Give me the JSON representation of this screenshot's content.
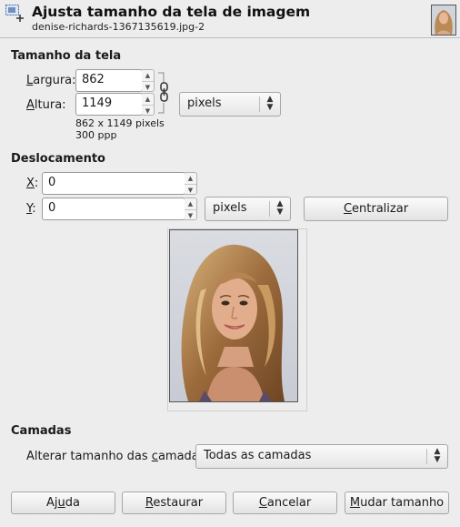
{
  "header": {
    "title": "Ajusta tamanho da tela de imagem",
    "subtitle": "denise-richards-1367135619.jpg-2",
    "icon": "canvas-size-icon",
    "thumbnail": "portrait-thumbnail"
  },
  "canvas_size": {
    "section_title": "Tamanho da tela",
    "width_label_prefix": "L",
    "width_label_rest": "argura:",
    "width_value": "862",
    "height_label_prefix": "A",
    "height_label_rest": "ltura:",
    "height_value": "1149",
    "unit": "pixels",
    "info_size": "862 x 1149 pixels",
    "info_resolution": "300 ppp",
    "chain_icon": "chain-link-icon"
  },
  "offset": {
    "section_title": "Deslocamento",
    "x_label_prefix": "X",
    "x_label_rest": ":",
    "x_value": "0",
    "y_label_prefix": "Y",
    "y_label_rest": ":",
    "y_value": "0",
    "unit": "pixels",
    "center_prefix": "C",
    "center_rest": "entralizar"
  },
  "layers": {
    "section_title": "Camadas",
    "resize_label_pre": "Alterar tamanho das ",
    "resize_label_ul": "c",
    "resize_label_post": "amadas",
    "resize_value": "Todas as camadas"
  },
  "buttons": {
    "help_pre": "Aj",
    "help_ul": "u",
    "help_post": "da",
    "reset_ul": "R",
    "reset_post": "estaurar",
    "cancel_ul": "C",
    "cancel_post": "ancelar",
    "resize_ul": "M",
    "resize_post": "udar tamanho"
  },
  "spinner": {
    "up": "▲",
    "down": "▼"
  },
  "combo_arrows": {
    "up": "▲",
    "down": "▼"
  }
}
